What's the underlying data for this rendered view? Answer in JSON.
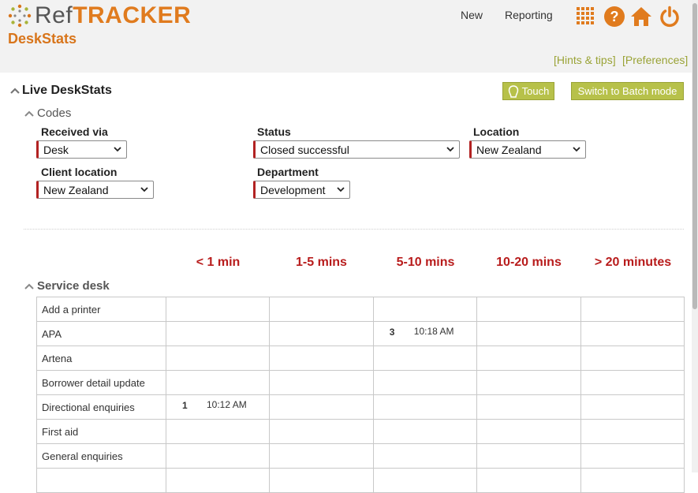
{
  "header": {
    "logo": {
      "ref": "Ref",
      "tracker": "TRACKER"
    },
    "subtitle": "DeskStats",
    "nav": {
      "new_label": "New",
      "reporting_label": "Reporting"
    },
    "icons": [
      "apps-grid-icon",
      "help-icon",
      "home-icon",
      "power-icon"
    ],
    "hints_link": "[Hints & tips]",
    "preferences_link": "[Preferences]"
  },
  "live": {
    "title": "Live DeskStats",
    "touch_label": "Touch",
    "batch_label": "Switch to Batch mode"
  },
  "codes": {
    "title": "Codes",
    "received_via": {
      "label": "Received via",
      "value": "Desk"
    },
    "status": {
      "label": "Status",
      "value": "Closed successful"
    },
    "location": {
      "label": "Location",
      "value": "New Zealand"
    },
    "client_location": {
      "label": "Client location",
      "value": "New Zealand"
    },
    "department": {
      "label": "Department",
      "value": "Development"
    }
  },
  "time_columns": [
    "< 1 min",
    "1-5 mins",
    "5-10 mins",
    "10-20 mins",
    "> 20 minutes"
  ],
  "service_desk": {
    "title": "Service desk",
    "rows": [
      {
        "label": "Add a printer",
        "cells": [
          null,
          null,
          null,
          null,
          null
        ]
      },
      {
        "label": "APA",
        "cells": [
          null,
          null,
          {
            "count": "3",
            "time": "10:18 AM"
          },
          null,
          null
        ]
      },
      {
        "label": "Artena",
        "cells": [
          null,
          null,
          null,
          null,
          null
        ]
      },
      {
        "label": "Borrower detail update",
        "cells": [
          null,
          null,
          null,
          null,
          null
        ]
      },
      {
        "label": "Directional enquiries",
        "cells": [
          {
            "count": "1",
            "time": "10:12 AM"
          },
          null,
          null,
          null,
          null
        ]
      },
      {
        "label": "First aid",
        "cells": [
          null,
          null,
          null,
          null,
          null
        ]
      },
      {
        "label": "General enquiries",
        "cells": [
          null,
          null,
          null,
          null,
          null
        ]
      },
      {
        "label": "",
        "cells": [
          null,
          null,
          null,
          null,
          null
        ]
      }
    ]
  },
  "colors": {
    "brand_orange": "#e07b1e",
    "olive": "#b7c14a",
    "required_red": "#b22222",
    "time_red": "#b81c1c"
  }
}
